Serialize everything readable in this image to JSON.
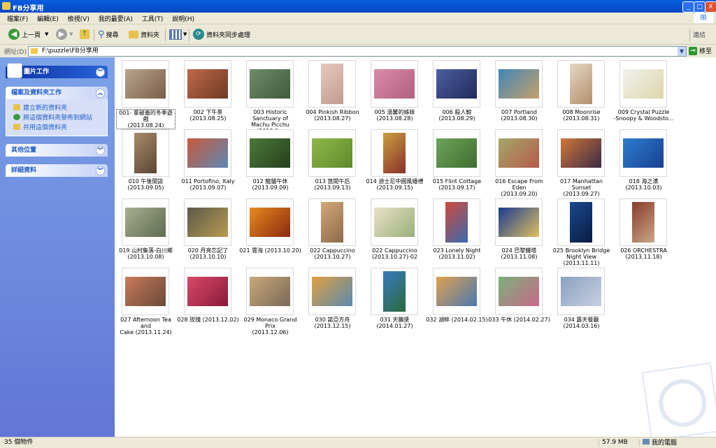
{
  "window": {
    "title": "FB分享用",
    "buttons": [
      "_",
      "□",
      "X"
    ]
  },
  "menu": [
    "檔案(F)",
    "編輯(E)",
    "檢視(V)",
    "我的最愛(A)",
    "工具(T)",
    "說明(H)"
  ],
  "toolbar": {
    "back": "上一頁",
    "search": "搜尋",
    "folders": "資料夾",
    "sync": "資料夾同步處理",
    "links": "連結"
  },
  "address": {
    "label": "網址(D)",
    "value": "F:\\puzzle\\FB分享用",
    "go": "移至"
  },
  "sidebar": {
    "picture_tasks": "圖片工作",
    "file_tasks": {
      "title": "檔案及資料夾工作",
      "links": [
        "建立新的資料夾",
        "將這個資料夾發佈到網站",
        "共用這個資料夾"
      ]
    },
    "other_places": "其他位置",
    "details": "詳細資料"
  },
  "items": [
    {
      "line1": "001- 拿破崙的冬季遊戲",
      "line2": "(2013.08.24)",
      "c1": "#b9a58f",
      "c2": "#7a5d48",
      "selected": true
    },
    {
      "line1": "002 下午茶",
      "line2": "(2013.08.25)",
      "c1": "#c06848",
      "c2": "#6e3b24"
    },
    {
      "line1": "003 Historic Sanctuary of",
      "line2": "Machu Picchu (2013.0...",
      "c1": "#6f8d6a",
      "c2": "#3d5a3b"
    },
    {
      "line1": "004 Pinkish Ribbon",
      "line2": "(2013.08.27)",
      "c1": "#e7c9bf",
      "c2": "#c09b8e"
    },
    {
      "line1": "005 溫馨的姊妹",
      "line2": "(2013.08.28)",
      "c1": "#d98ca8",
      "c2": "#b0607e"
    },
    {
      "line1": "006 殺人鯨",
      "line2": "(2013.08.29)",
      "c1": "#4d5fa0",
      "c2": "#1f2a5a"
    },
    {
      "line1": "007 Portland",
      "line2": "(2013.08.30)",
      "c1": "#3f86b8",
      "c2": "#c7a06a"
    },
    {
      "line1": "008 Moonrise",
      "line2": "(2013.08.31)",
      "c1": "#e6d6c4",
      "c2": "#b28f6c"
    },
    {
      "line1": "009 Crystal Puzzle",
      "line2": "-Snoopy & Woodsto...",
      "c1": "#f1f1ee",
      "c2": "#dcd6a8"
    },
    {
      "line1": "010 午後閒談",
      "line2": "(2013.09.05)",
      "c1": "#a88b6b",
      "c2": "#5a4634"
    },
    {
      "line1": "011 Portofino, Italy",
      "line2": "(2013.09.07)",
      "c1": "#c85a3a",
      "c2": "#5d87b5"
    },
    {
      "line1": "012 龍貓午休",
      "line2": "(2013.09.09)",
      "c1": "#4b7a3a",
      "c2": "#263e1e"
    },
    {
      "line1": "013 悠閒午后",
      "line2": "(2013.09.13)",
      "c1": "#8fb84a",
      "c2": "#5c8a2a"
    },
    {
      "line1": "014 迪士尼中國風婚禮",
      "line2": "(2013.09.15)",
      "c1": "#c9a040",
      "c2": "#8b2f2a"
    },
    {
      "line1": "015 Flint Cottage",
      "line2": "(2013.09.17)",
      "c1": "#6fa45a",
      "c2": "#3f6d2f"
    },
    {
      "line1": "016 Escape From Eden",
      "line2": "(2013.09.20)",
      "c1": "#a6a86a",
      "c2": "#b45a4a"
    },
    {
      "line1": "017 Manhattan Sunset",
      "line2": "(2013.09.27)",
      "c1": "#d0783a",
      "c2": "#3a2a44"
    },
    {
      "line1": "018 海之濱",
      "line2": "(2013.10.03)",
      "c1": "#2c7fd0",
      "c2": "#1a3f90"
    },
    {
      "line1": "019 山村集落-白川鄉",
      "line2": "(2013.10.08)",
      "c1": "#a8b090",
      "c2": "#5f6a50"
    },
    {
      "line1": "020 月亮忘記了",
      "line2": "(2013.10.10)",
      "c1": "#5c5a4a",
      "c2": "#b89a50"
    },
    {
      "line1": "021 雲海 (2013.10.20)",
      "line2": "",
      "c1": "#e88a20",
      "c2": "#8a2a10"
    },
    {
      "line1": "022 Cappuccino",
      "line2": "(2013.10.27)",
      "c1": "#d4a878",
      "c2": "#8a6a4a"
    },
    {
      "line1": "022 Cappuccino",
      "line2": "(2013.10.27)-02",
      "c1": "#e8e0c8",
      "c2": "#9ab07a"
    },
    {
      "line1": "023 Lonely Night",
      "line2": "(2013.11.02)",
      "c1": "#d04a3a",
      "c2": "#3a6ab0"
    },
    {
      "line1": "024 巴黎鐵塔",
      "line2": "(2013.11.08)",
      "c1": "#1a3a90",
      "c2": "#e0c060"
    },
    {
      "line1": "025 Brooklyn Bridge",
      "line2": "Night View (2013.11.11)",
      "c1": "#1a4a90",
      "c2": "#0a1a40"
    },
    {
      "line1": "026 ORCHESTRA",
      "line2": "(2013.11.18)",
      "c1": "#8a3a2a",
      "c2": "#c8a888"
    },
    {
      "line1": "027 Afternoon Tea and",
      "line2": "Cake (2013.11.24)",
      "c1": "#c87a5a",
      "c2": "#6a4a3a"
    },
    {
      "line1": "028 玫瑰 (2013.12.02)",
      "line2": "",
      "c1": "#d84a6a",
      "c2": "#8a1a3a"
    },
    {
      "line1": "029 Monaco Grand Prix",
      "line2": "(2013.12.06)",
      "c1": "#c8a878",
      "c2": "#7a6a5a"
    },
    {
      "line1": "030 諾亞方舟",
      "line2": "(2013.12.15)",
      "c1": "#e0a040",
      "c2": "#5a8ab0"
    },
    {
      "line1": "031 天鵝堡",
      "line2": "(2014.01.27)",
      "c1": "#3a7ac0",
      "c2": "#2a6a3a"
    },
    {
      "line1": "032 湖畔 (2014.02.15)",
      "line2": "",
      "c1": "#e0a050",
      "c2": "#4a7ab0"
    },
    {
      "line1": "033 午休 (2014.02.27)",
      "line2": "",
      "c1": "#7ab07a",
      "c2": "#c86a8a"
    },
    {
      "line1": "034 露天餐廳",
      "line2": "(2014.03.16)",
      "c1": "#8aa0c0",
      "c2": "#c8d0e0"
    }
  ],
  "status": {
    "count": "35 個物件",
    "size": "57.9 MB",
    "location": "我的電腦"
  }
}
